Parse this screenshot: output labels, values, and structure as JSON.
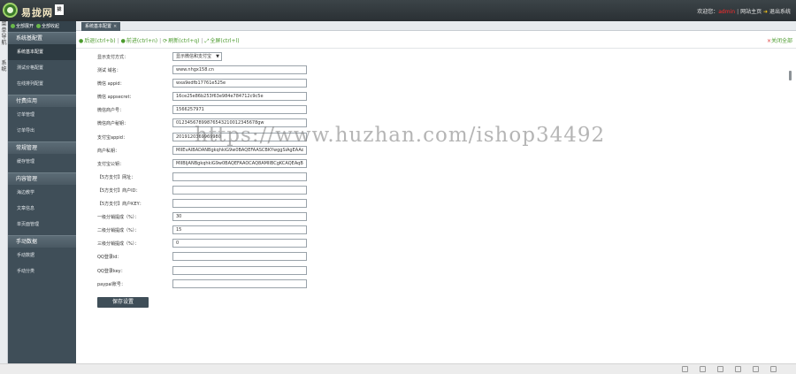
{
  "header": {
    "logo_text": "易拢网",
    "logo_badge": "拢",
    "welcome_prefix": "欢迎您：",
    "username": "admin",
    "site_home": "网站主页",
    "logout": "退出系统"
  },
  "vertical_tabs": [
    "菜单导航",
    "系统"
  ],
  "sidebar": {
    "expand_all": "全部展开",
    "collapse_all": "全部收起",
    "groups": [
      {
        "title": "系统基配置",
        "items": [
          "系统基本配置",
          "测试价格配置",
          "在线排列配置"
        ]
      },
      {
        "title": "付费应用",
        "items": [
          "订单管理",
          "订单导出"
        ]
      },
      {
        "title": "常规管理",
        "items": [
          "缓存管理"
        ]
      },
      {
        "title": "内容管理",
        "items": [
          "海边教学",
          "文章信息",
          "单页面管理"
        ]
      },
      {
        "title": "手动数据",
        "items": [
          "手动数据",
          "手动分类"
        ]
      }
    ]
  },
  "tab": {
    "label": "系统基本配置",
    "close": "×"
  },
  "toolbar": {
    "back": "后退(ctrl+b)",
    "forward": "前进(ctrl+n)",
    "refresh": "刷新(ctrl+q)",
    "fullscreen": "全屏(ctrl+l)",
    "close_all": "关闭全部"
  },
  "form": {
    "fields": [
      {
        "label": "显示支付方式：",
        "value": "显示微信和支付宝",
        "type": "select"
      },
      {
        "label": "测试 域名：",
        "value": "www.nhgx158.cn"
      },
      {
        "label": "微信 appid：",
        "value": "wxa9edfb17761e525e"
      },
      {
        "label": "微信 appsecret：",
        "value": "16ce25e86b253f63e984e784712c9c5e"
      },
      {
        "label": "微信商户号：",
        "value": "1566257971"
      },
      {
        "label": "微信商户秘钥：",
        "value": "01234567899876543210012345678gw"
      },
      {
        "label": "支付宝appid：",
        "value": "2019120369969980"
      },
      {
        "label": "商户私钥：",
        "value": "MIIEvAIBADANBgkqhkiG9w0BAQEFAASCBKYwggSiAgEAAoIB"
      },
      {
        "label": "支付宝公钥：",
        "value": "MIIBIjANBgkqhkiG9w0BAQEFAAOCAQ8AMIIBCgKCAQEAqB"
      },
      {
        "label": "【5方支付】网址：",
        "value": ""
      },
      {
        "label": "【5方支付】商户ID：",
        "value": ""
      },
      {
        "label": "【5方支付】商户KEY：",
        "value": ""
      },
      {
        "label": "一级分销提成（%）：",
        "value": "30"
      },
      {
        "label": "二级分销提成（%）：",
        "value": "15"
      },
      {
        "label": "三级分销提成（%）：",
        "value": "0"
      },
      {
        "label": "QQ登录id：",
        "value": ""
      },
      {
        "label": "QQ登录key：",
        "value": ""
      },
      {
        "label": "paypal账号：",
        "value": ""
      }
    ],
    "save_label": "保存设置"
  },
  "watermark": "https://www.huzhan.com/ishop34492",
  "colors": {
    "topbar": "#2f363a",
    "sidebar": "#3f4e58",
    "accent_green": "#4c9b2e",
    "username_red": "#ff2a2a"
  }
}
